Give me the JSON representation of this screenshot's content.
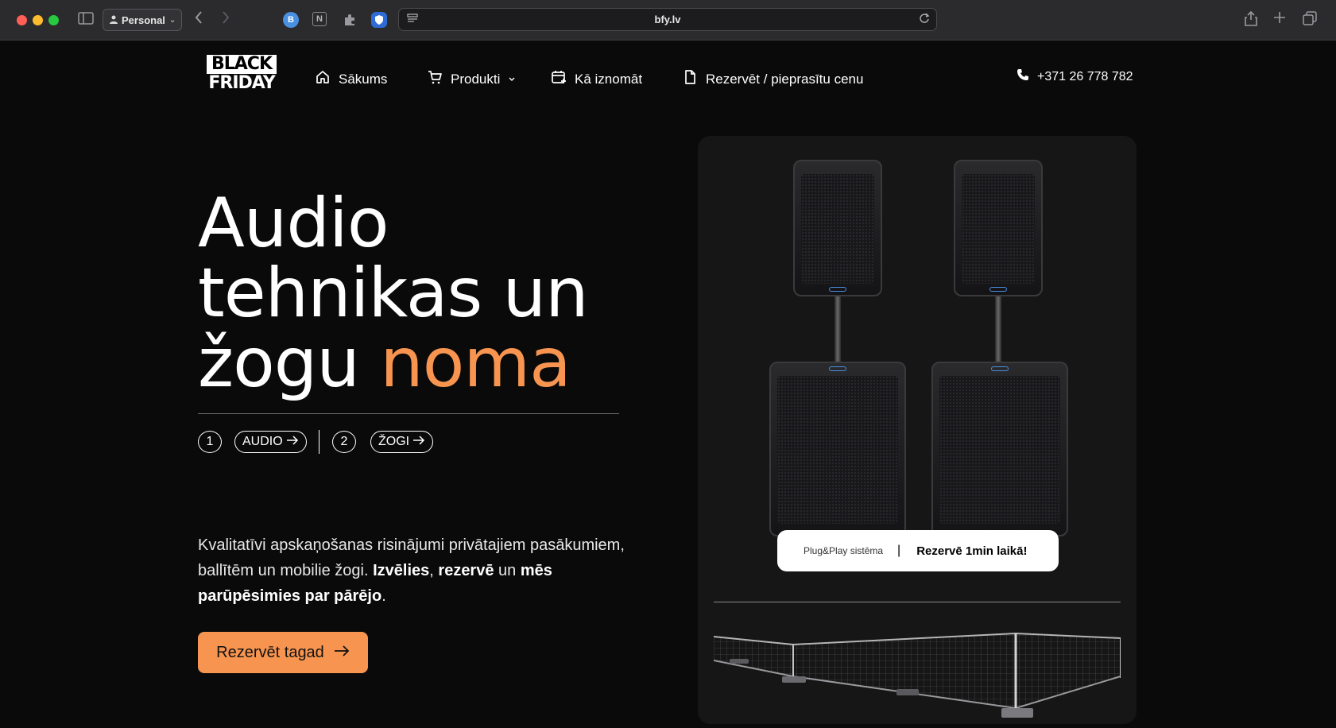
{
  "browser": {
    "profile_label": "Personal",
    "url": "bfy.lv"
  },
  "logo": {
    "line1": "BLACK",
    "line2": "FRIDAY"
  },
  "nav": {
    "home": "Sākums",
    "products": "Produkti",
    "how_to_rent": "Kā iznomāt",
    "reserve": "Rezervēt / pieprasītu cenu",
    "phone": "+371 26 778 782"
  },
  "hero": {
    "title_line1": "Audio",
    "title_line2": "tehnikas un",
    "title_line3": "žogu",
    "title_accent": "noma",
    "step1_num": "1",
    "step1_label": "AUDIO",
    "step2_num": "2",
    "step2_label": "ŽOGI",
    "desc_part1": "Kvalitatīvi apskaņošanas risinājumi privātajiem pasākumiem, ballītēm un mobilie žogi. ",
    "desc_bold1": "Izvēlies",
    "desc_part2": ", ",
    "desc_bold2": "rezervē",
    "desc_part3": " un ",
    "desc_bold3": "mēs parūpēsimies par pārējo",
    "desc_part4": ".",
    "cta_label": "Rezervēt tagad"
  },
  "card": {
    "info_small": "Plug&Play sistēma",
    "info_sep": "|",
    "info_bold": "Rezervē 1min laikā!"
  },
  "colors": {
    "accent": "#f79550",
    "background": "#0a0a0a",
    "card": "#161616"
  }
}
